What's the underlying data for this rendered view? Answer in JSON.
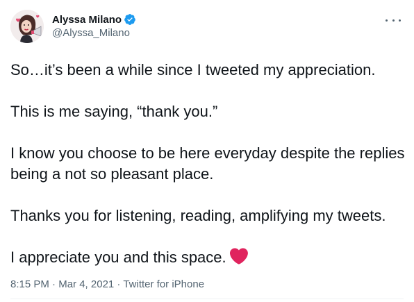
{
  "user": {
    "display_name": "Alyssa Milano",
    "handle": "@Alyssa_Milano",
    "verified": true
  },
  "tweet": {
    "paragraphs": [
      "So…it’s been a while since I tweeted my appreciation.",
      "This is me saying, “thank you.”",
      "I know you choose to be here everyday despite the replies being a not so pleasant place.",
      "Thanks you for listening, reading, amplifying my tweets.",
      "I appreciate you and this space."
    ],
    "emoji": "red-heart"
  },
  "meta": {
    "time": "8:15 PM",
    "separator_1": " · ",
    "date": "Mar 4, 2021",
    "separator_2": " · ",
    "source": "Twitter for iPhone"
  },
  "icons": {
    "verified": "verified-badge-icon",
    "more": "more-options-icon",
    "heart": "heart-icon"
  },
  "colors": {
    "verified": "#1d9bf0",
    "heart": "#e0245e",
    "secondary_text": "#536471"
  }
}
